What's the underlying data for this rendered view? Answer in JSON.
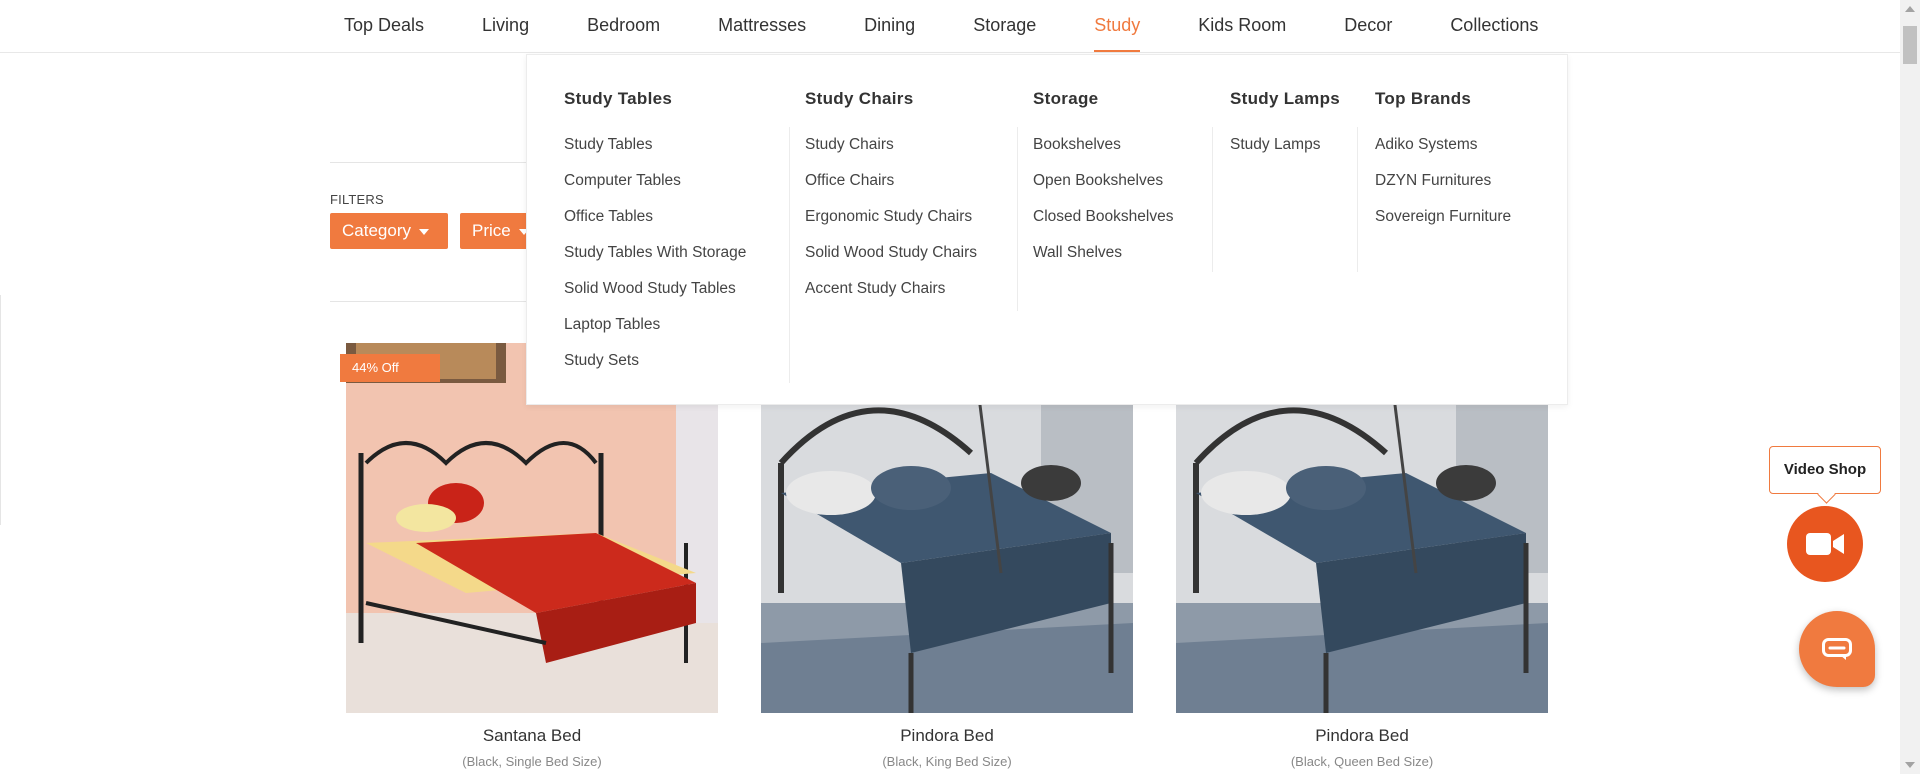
{
  "nav": {
    "items": [
      "Top Deals",
      "Living",
      "Bedroom",
      "Mattresses",
      "Dining",
      "Storage",
      "Study",
      "Kids Room",
      "Decor",
      "Collections"
    ],
    "active": "Study"
  },
  "filters": {
    "label": "FILTERS",
    "category": "Category",
    "price": "Price"
  },
  "mega_menu": {
    "columns": [
      {
        "title": "Study Tables",
        "items": [
          "Study Tables",
          "Computer Tables",
          "Office Tables",
          "Study Tables With Storage",
          "Solid Wood Study Tables",
          "Laptop Tables",
          "Study Sets"
        ]
      },
      {
        "title": "Study Chairs",
        "items": [
          "Study Chairs",
          "Office Chairs",
          "Ergonomic Study Chairs",
          "Solid Wood Study Chairs",
          "Accent Study Chairs"
        ]
      },
      {
        "title": "Storage",
        "items": [
          "Bookshelves",
          "Open Bookshelves",
          "Closed Bookshelves",
          "Wall Shelves"
        ]
      },
      {
        "title": "Study Lamps",
        "items": [
          "Study Lamps"
        ]
      },
      {
        "title": "Top Brands",
        "items": [
          "Adiko Systems",
          "DZYN Furnitures",
          "Sovereign Furniture"
        ]
      }
    ]
  },
  "products": [
    {
      "name": "Santana Bed",
      "variant": "(Black, Single Bed Size)",
      "badge": "44% Off"
    },
    {
      "name": "Pindora Bed",
      "variant": "(Black, King Bed Size)"
    },
    {
      "name": "Pindora Bed",
      "variant": "(Black, Queen Bed Size)"
    }
  ],
  "video_shop": {
    "label": "Video Shop"
  },
  "colors": {
    "accent": "#f07a3f",
    "video_button": "#e8561f"
  }
}
